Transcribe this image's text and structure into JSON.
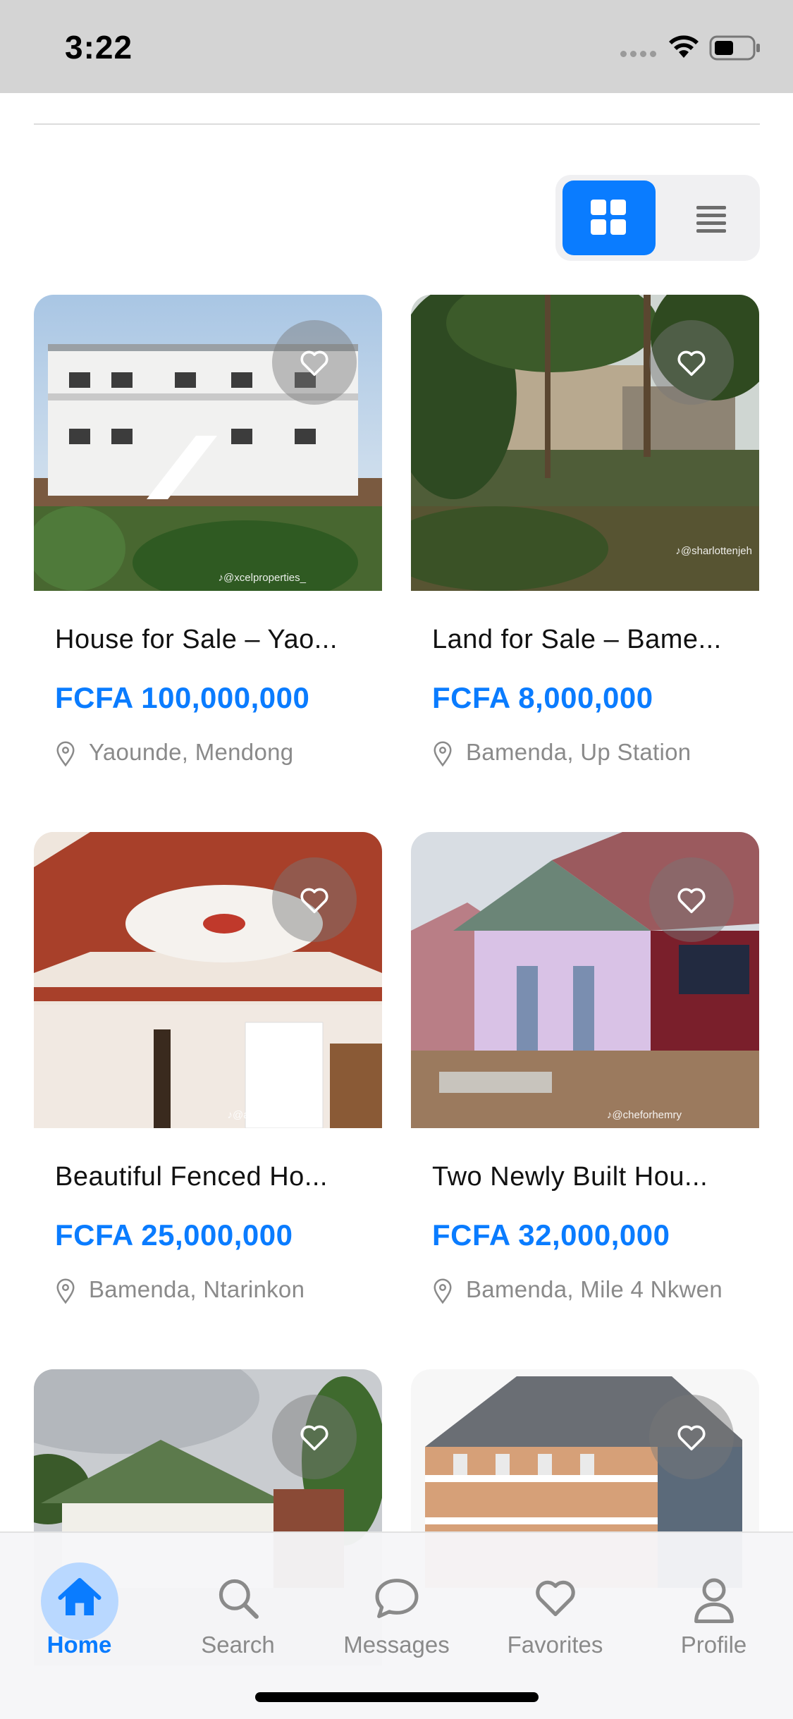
{
  "status_bar": {
    "time": "3:22"
  },
  "view_toggle": {
    "active": "grid"
  },
  "listings": [
    {
      "title": "House for Sale – Yao...",
      "price": "FCFA 100,000,000",
      "location": "Yaounde, Mendong",
      "watermark": "@xcelproperties_",
      "favorited": false
    },
    {
      "title": "Land for Sale – Bame...",
      "price": "FCFA 8,000,000",
      "location": "Bamenda, Up Station",
      "watermark": "@sharlottenjeh",
      "favorited": false
    },
    {
      "title": "Beautiful Fenced Ho...",
      "price": "FCFA 25,000,000",
      "location": "Bamenda, Ntarinkon",
      "watermark": "@agentnjume1",
      "favorited": false
    },
    {
      "title": "Two Newly Built Hou...",
      "price": "FCFA 32,000,000",
      "location": "Bamenda, Mile 4 Nkwen",
      "watermark": "@cheforhemry",
      "favorited": false
    },
    {
      "title": "",
      "price": "",
      "location": "",
      "watermark": "",
      "favorited": false
    },
    {
      "title": "",
      "price": "",
      "location": "",
      "watermark": "",
      "favorited": false
    }
  ],
  "tab_bar": {
    "items": [
      {
        "label": "Home",
        "icon": "house-icon",
        "active": true
      },
      {
        "label": "Search",
        "icon": "magnifier-icon",
        "active": false
      },
      {
        "label": "Messages",
        "icon": "chat-bubble-icon",
        "active": false
      },
      {
        "label": "Favorites",
        "icon": "heart-icon",
        "active": false
      },
      {
        "label": "Profile",
        "icon": "person-icon",
        "active": false
      }
    ]
  },
  "colors": {
    "accent": "#0a7cff",
    "price": "#0a7cff",
    "muted": "#8a8a8a"
  }
}
